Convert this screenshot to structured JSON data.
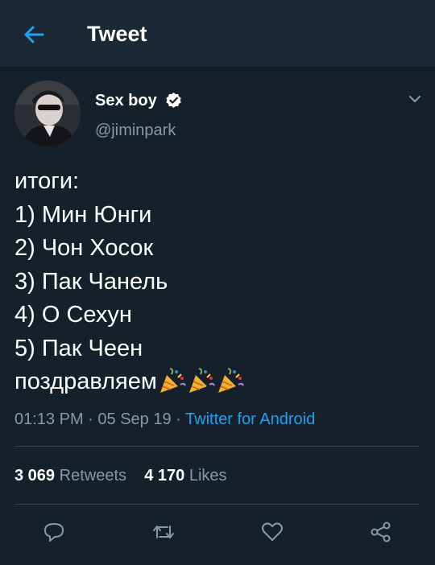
{
  "header": {
    "title": "Tweet",
    "back_icon": "arrow-left-icon"
  },
  "user": {
    "display_name": "Sex boy",
    "handle": "@jiminpark",
    "verified": true
  },
  "tweet": {
    "lines": [
      "итоги:",
      "1) Мин Юнги",
      "2) Чон Хосок",
      "3) Пак Чанель",
      "4) О Сехун",
      "5) Пак Чеен",
      "поздравляем"
    ],
    "emoji": [
      "party-popper",
      "party-popper",
      "party-popper"
    ],
    "time": "01:13 PM",
    "date": "05 Sep 19",
    "source": "Twitter for Android"
  },
  "stats": {
    "retweets_count": "3 069",
    "retweets_label": "Retweets",
    "likes_count": "4 170",
    "likes_label": "Likes"
  },
  "actions": [
    "reply-icon",
    "retweet-icon",
    "like-icon",
    "share-icon"
  ],
  "colors": {
    "background": "#15202b",
    "header_bg": "#1b2836",
    "accent": "#1da1f2",
    "muted": "#8899a6",
    "divider": "#38444d"
  }
}
